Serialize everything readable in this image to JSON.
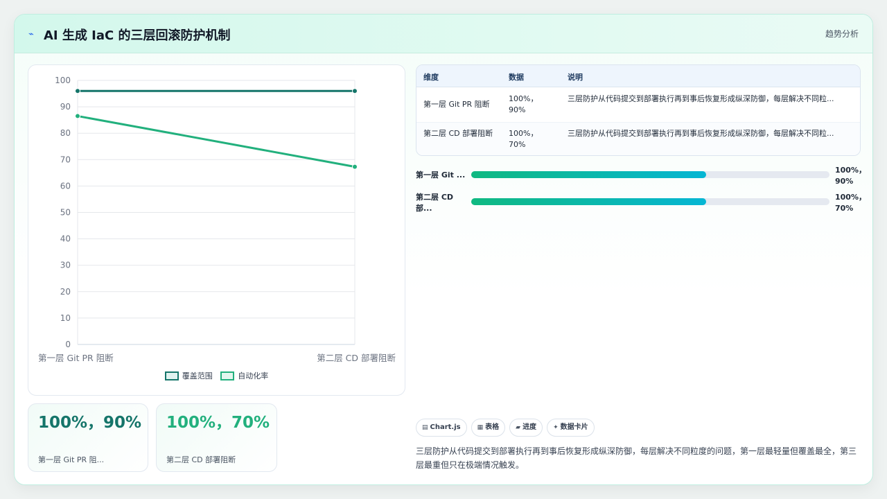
{
  "header": {
    "icon": "trend-line-icon",
    "title": "AI 生成 IaC 的三层回滚防护机制",
    "tag": "趋势分析"
  },
  "chart_data": {
    "type": "line",
    "categories": [
      "第一层 Git PR 阻断",
      "第二层 CD 部署阻断"
    ],
    "series": [
      {
        "name": "覆盖范围",
        "values": [
          96,
          96
        ],
        "color": "#15756a"
      },
      {
        "name": "自动化率",
        "values": [
          86.5,
          67.3
        ],
        "color": "#22b07d"
      }
    ],
    "ylim": [
      0,
      100
    ],
    "yticks": [
      0,
      10,
      20,
      30,
      40,
      50,
      60,
      70,
      80,
      90,
      100
    ],
    "grid": true,
    "legend": "bottom"
  },
  "stats": [
    {
      "value": "100%，90%",
      "label": "第一层 Git PR 阻...",
      "color": "#15756a"
    },
    {
      "value": "100%，70%",
      "label": "第二层 CD 部署阻断",
      "color": "#22b07d"
    }
  ],
  "table": {
    "headers": [
      "维度",
      "数据",
      "说明"
    ],
    "rows": [
      {
        "dim": "第一层 Git PR 阻断",
        "data": "100%，90%",
        "desc": "三层防护从代码提交到部署执行再到事后恢复形成纵深防御，每层解决不同粒..."
      },
      {
        "dim": "第二层 CD 部署阻断",
        "data": "100%，70%",
        "desc": "三层防护从代码提交到部署执行再到事后恢复形成纵深防御，每层解决不同粒..."
      }
    ]
  },
  "progress": [
    {
      "label": "第一层 Git ...",
      "value_text": "100%，90%",
      "fraction": 0.655
    },
    {
      "label": "第二层 CD 部...",
      "value_text": "100%，70%",
      "fraction": 0.655
    }
  ],
  "chips": [
    {
      "icon": "chart-icon",
      "glyph": "▤",
      "label": "Chart.js"
    },
    {
      "icon": "table-icon",
      "glyph": "▦",
      "label": "表格"
    },
    {
      "icon": "progress-icon",
      "glyph": "▰",
      "label": "进度"
    },
    {
      "icon": "sparkle-icon",
      "glyph": "✦",
      "label": "数据卡片"
    }
  ],
  "description": "三层防护从代码提交到部署执行再到事后恢复形成纵深防御，每层解决不同粒度的问题，第一层最轻量但覆盖最全，第三层最重但只在极端情况触发。"
}
